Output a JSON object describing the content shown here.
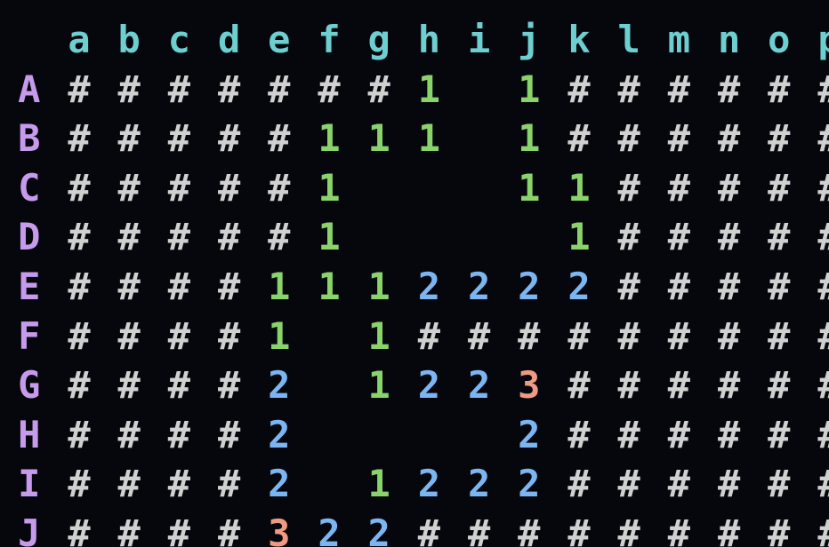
{
  "board": {
    "column_labels": [
      "a",
      "b",
      "c",
      "d",
      "e",
      "f",
      "g",
      "h",
      "i",
      "j",
      "k",
      "l",
      "m",
      "n",
      "o",
      "p"
    ],
    "rows": [
      {
        "label": "A",
        "cells": [
          "#",
          "#",
          "#",
          "#",
          "#",
          "#",
          "#",
          "1",
          " ",
          "1",
          "#",
          "#",
          "#",
          "#",
          "#",
          "#"
        ]
      },
      {
        "label": "B",
        "cells": [
          "#",
          "#",
          "#",
          "#",
          "#",
          "1",
          "1",
          "1",
          " ",
          "1",
          "#",
          "#",
          "#",
          "#",
          "#",
          "#"
        ]
      },
      {
        "label": "C",
        "cells": [
          "#",
          "#",
          "#",
          "#",
          "#",
          "1",
          " ",
          " ",
          " ",
          "1",
          "1",
          "#",
          "#",
          "#",
          "#",
          "#"
        ]
      },
      {
        "label": "D",
        "cells": [
          "#",
          "#",
          "#",
          "#",
          "#",
          "1",
          " ",
          " ",
          " ",
          " ",
          "1",
          "#",
          "#",
          "#",
          "#",
          "#"
        ]
      },
      {
        "label": "E",
        "cells": [
          "#",
          "#",
          "#",
          "#",
          "1",
          "1",
          "1",
          "2",
          "2",
          "2",
          "2",
          "#",
          "#",
          "#",
          "#",
          "#"
        ]
      },
      {
        "label": "F",
        "cells": [
          "#",
          "#",
          "#",
          "#",
          "1",
          " ",
          "1",
          "#",
          "#",
          "#",
          "#",
          "#",
          "#",
          "#",
          "#",
          "#"
        ]
      },
      {
        "label": "G",
        "cells": [
          "#",
          "#",
          "#",
          "#",
          "2",
          " ",
          "1",
          "2",
          "2",
          "3",
          "#",
          "#",
          "#",
          "#",
          "#",
          "#"
        ]
      },
      {
        "label": "H",
        "cells": [
          "#",
          "#",
          "#",
          "#",
          "2",
          " ",
          " ",
          " ",
          " ",
          "2",
          "#",
          "#",
          "#",
          "#",
          "#",
          "#"
        ]
      },
      {
        "label": "I",
        "cells": [
          "#",
          "#",
          "#",
          "#",
          "2",
          " ",
          "1",
          "2",
          "2",
          "2",
          "#",
          "#",
          "#",
          "#",
          "#",
          "#"
        ]
      },
      {
        "label": "J",
        "cells": [
          "#",
          "#",
          "#",
          "#",
          "3",
          "2",
          "2",
          "#",
          "#",
          "#",
          "#",
          "#",
          "#",
          "#",
          "#",
          "#"
        ]
      }
    ]
  },
  "colors": {
    "background": "#05070c",
    "column_label": "#6ecfd0",
    "row_label": "#c79bec",
    "hidden": "#d0d0d0",
    "number_1": "#8ad36b",
    "number_2": "#7cb6f2",
    "number_3": "#ef9a83"
  }
}
